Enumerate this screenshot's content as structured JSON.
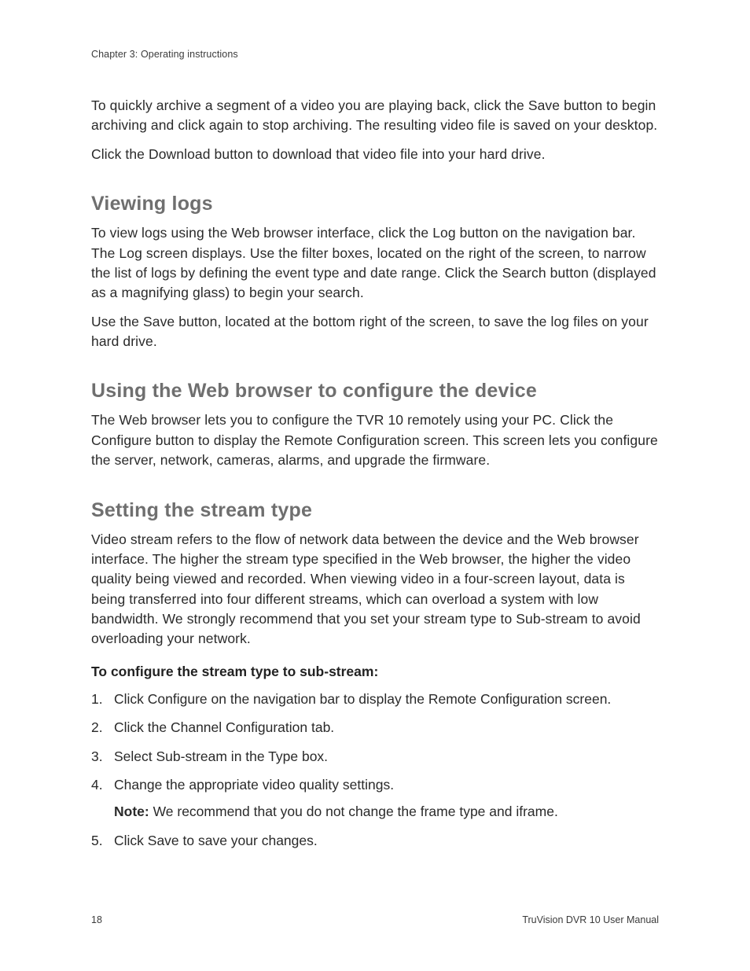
{
  "header": {
    "chapter": "Chapter 3: Operating instructions"
  },
  "intro": {
    "p1": "To quickly archive a segment of a video you are playing back, click the Save button to begin archiving and click again to stop archiving. The resulting video file is saved on your desktop.",
    "p2": "Click the Download button to download that video file into your hard drive."
  },
  "sections": {
    "viewing_logs": {
      "title": "Viewing logs",
      "p1": "To view logs using the Web browser interface, click the Log button on the navigation bar. The Log screen displays. Use the filter boxes, located on the right of the screen, to narrow the list of logs by defining the event type and date range. Click the Search button (displayed as a magnifying glass) to begin your search.",
      "p2": "Use the Save button, located at the bottom right of the screen, to save the log files on your hard drive."
    },
    "web_config": {
      "title": "Using the Web browser to configure the device",
      "p1": "The Web browser lets you to configure the TVR 10 remotely using your PC. Click the Configure button to display the Remote Configuration screen. This screen lets you configure the server, network, cameras, alarms, and upgrade the firmware."
    },
    "stream_type": {
      "title": "Setting the stream type",
      "p1": "Video stream refers to the flow of network data between the device and the Web browser interface. The higher the stream type specified in the Web browser, the higher the video quality being viewed and recorded. When viewing video in a four-screen layout, data is being transferred into four different streams, which can overload a system with low bandwidth. We strongly recommend that you set your stream type to Sub-stream to avoid overloading your network.",
      "procedure_title": "To configure the stream type to sub-stream:",
      "steps": [
        "Click Configure on the navigation bar to display the Remote Configuration screen.",
        "Click the Channel Configuration tab.",
        "Select Sub-stream in the Type box.",
        "Change the appropriate video quality settings.",
        "Click Save to save your changes."
      ],
      "note_label": "Note:",
      "note_text": " We recommend that you do not change the frame type and iframe."
    }
  },
  "footer": {
    "page_number": "18",
    "manual_title": "TruVision DVR 10 User Manual"
  }
}
